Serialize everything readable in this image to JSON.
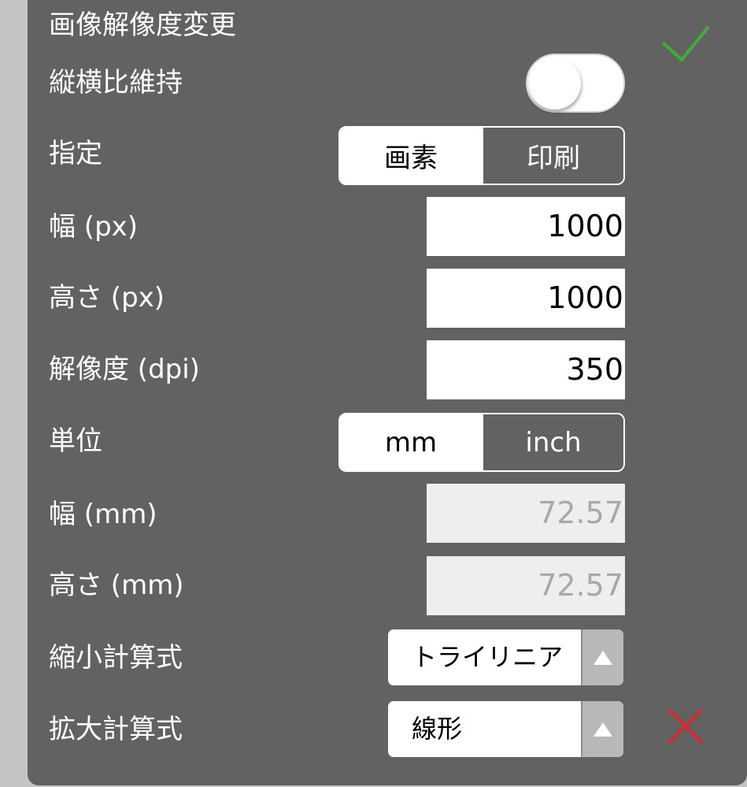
{
  "dialog": {
    "title": "画像解像度変更",
    "confirm_icon": "check-icon",
    "cancel_icon": "close-icon",
    "accent_confirm": "#3fae36",
    "accent_cancel": "#d6292b"
  },
  "aspect_ratio": {
    "label": "縦横比維持",
    "enabled": false
  },
  "spec": {
    "label": "指定",
    "options": [
      "画素",
      "印刷"
    ],
    "selected": "画素"
  },
  "width_px": {
    "label": "幅 (px)",
    "value": "1000"
  },
  "height_px": {
    "label": "高さ (px)",
    "value": "1000"
  },
  "resolution": {
    "label": "解像度 (dpi)",
    "value": "350"
  },
  "unit": {
    "label": "単位",
    "options": [
      "mm",
      "inch"
    ],
    "selected": "mm"
  },
  "width_mm": {
    "label": "幅 (mm)",
    "value": "72.57"
  },
  "height_mm": {
    "label": "高さ (mm)",
    "value": "72.57"
  },
  "shrink_method": {
    "label": "縮小計算式",
    "value": "トライリニア"
  },
  "enlarge_method": {
    "label": "拡大計算式",
    "value": "線形"
  }
}
